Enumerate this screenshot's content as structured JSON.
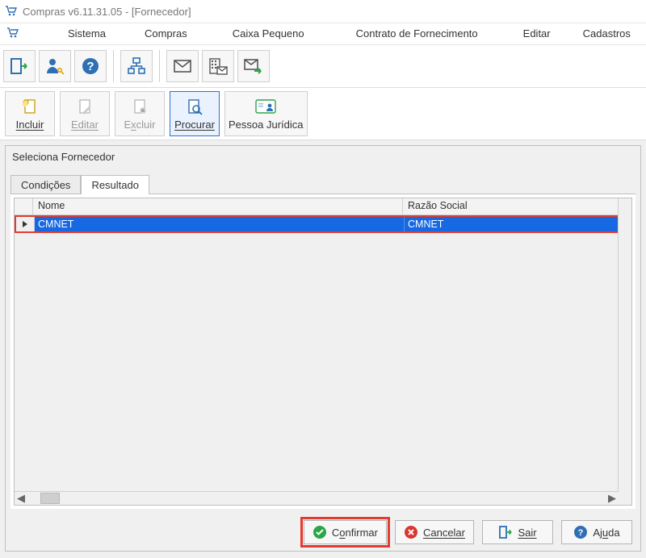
{
  "window": {
    "title": "Compras v6.11.31.05 - [Fornecedor]"
  },
  "menu": {
    "sistema": "Sistema",
    "compras": "Compras",
    "caixa": "Caixa Pequeno",
    "contrato": "Contrato de Fornecimento",
    "editar": "Editar",
    "cadastros": "Cadastros"
  },
  "toolbar": {
    "incluir": "Incluir",
    "editar": "Editar",
    "excluir": "Excluir",
    "procurar": "Procurar",
    "pessoa_juridica": "Pessoa Jurídica"
  },
  "panel": {
    "title": "Seleciona Fornecedor",
    "tabs": {
      "condicoes": "Condições",
      "resultado": "Resultado"
    }
  },
  "grid": {
    "columns": {
      "nome": "Nome",
      "razao_social": "Razão Social"
    },
    "rows": [
      {
        "nome": "CMNET",
        "razao_social": "CMNET"
      }
    ]
  },
  "buttons": {
    "confirmar": "Confirmar",
    "cancelar": "Cancelar",
    "sair": "Sair",
    "ajuda": "Ajuda"
  }
}
